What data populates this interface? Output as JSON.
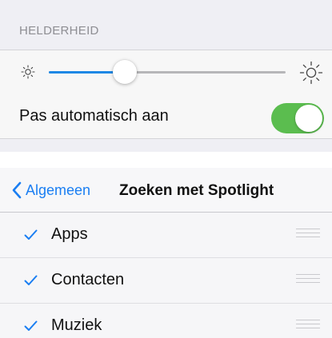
{
  "brightness": {
    "header": "HELDERHEID",
    "slider_value": 0.32,
    "auto_label": "Pas automatisch aan",
    "auto_enabled": true
  },
  "spotlight": {
    "back_label": "Algemeen",
    "title": "Zoeken met Spotlight",
    "items": [
      {
        "label": "Apps",
        "checked": true
      },
      {
        "label": "Contacten",
        "checked": true
      },
      {
        "label": "Muziek",
        "checked": true
      }
    ]
  },
  "colors": {
    "accent": "#1a7ef2",
    "toggle_on": "#5bbd4f",
    "panel_bg": "#efeff4"
  }
}
